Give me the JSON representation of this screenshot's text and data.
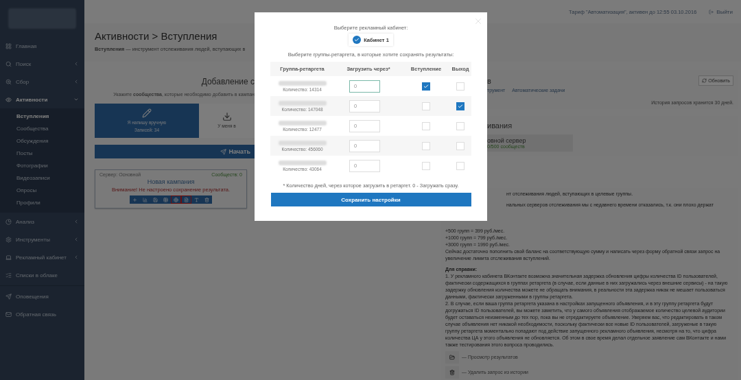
{
  "sidebar": {
    "items": [
      {
        "label": "Главная",
        "selected": false
      },
      {
        "label": "Поиск",
        "selected": false,
        "expanded": false
      },
      {
        "label": "Сбор",
        "selected": false,
        "expanded": false
      },
      {
        "label": "Активности",
        "selected": true,
        "expanded": true,
        "children": [
          {
            "label": "Вступления",
            "selected": true
          },
          {
            "label": "Сообщества",
            "selected": false
          },
          {
            "label": "Обсуждения",
            "selected": false
          },
          {
            "label": "Посты",
            "selected": false
          },
          {
            "label": "Фотографии",
            "selected": false
          },
          {
            "label": "Видеозаписи",
            "selected": false
          },
          {
            "label": "Опросы",
            "selected": false
          },
          {
            "label": "Профили",
            "selected": false
          }
        ]
      },
      {
        "label": "Анализ",
        "selected": false,
        "expanded": false
      },
      {
        "label": "Инструменты",
        "selected": false,
        "expanded": false
      },
      {
        "label": "Рекламный кабинет",
        "selected": false,
        "expanded": false
      },
      {
        "label": "Списки в облаке",
        "selected": false
      },
      {
        "label": "Оповещения",
        "selected": false
      },
      {
        "label": "Обратная связь",
        "selected": false
      }
    ]
  },
  "header": {
    "tariff": "Тариф \"Автоматизация\", активен до 12:55 03.10.2016",
    "logout": "Выйти"
  },
  "page": {
    "title": "Активности > Вступления",
    "subtitle": "**Вступления** — инструмент отслеживания людей, вступающих в"
  },
  "add_panel": {
    "heading": "Добавление с",
    "hint": "Укажите **сообщества**, которые необходимо добавить в кампан",
    "sources": [
      {
        "line1": "Я напишу вручную",
        "line2": "Записей: 34",
        "selected": true
      },
      {
        "line1": "У меня в",
        "selected": false
      }
    ],
    "start_button": "Начать"
  },
  "campaign": {
    "server": "Сервер: Основной",
    "count": "Сообществ: 0",
    "name": "Новая кампания",
    "warning": "Внимание! Не настроено сохранение результата.",
    "tools": [
      {
        "highlighted": false
      },
      {
        "highlighted": false
      },
      {
        "highlighted": false
      },
      {
        "highlighted": false
      },
      {
        "highlighted": true
      },
      {
        "highlighted": true
      },
      {
        "highlighted": false
      },
      {
        "highlighted": false
      }
    ]
  },
  "history_panel": {
    "heading": "в",
    "links": [
      "трумент",
      "Автоматические задачи"
    ],
    "refresh": "Обновить",
    "note": "История запросов хранится 30 дней."
  },
  "server_panel": {
    "heading": "ивания",
    "server": "овной сервер",
    "usage": "0/500 сообществ"
  },
  "info": {
    "cut_lines": [
      "нт отслеживания людей, вступающих в целевые группы.",
      "нальных серверов отслеживания мы с недавнего времени отказались, т.к. они плохо держат"
    ],
    "prices": [
      "+500 групп = 399 руб./мес.",
      "+1000 групп = 799 руб./мес.",
      "+3000 групп = 1990 руб./мес.",
      "Сейчас достаточно пополнить свой баланс на соответствующую сумму и написать через форму обратной связи запрос на увеличение лимита отслеживания вступлений."
    ],
    "ref_title": "Для справки:",
    "ref_text": [
      "1. У рекламного кабинета ВКонтакте возможна значительная задержка обновления цифры количества ID пользователей, фактически содержащихся в группах ретаргета (в случае, если данные в них загружались через внешние сервисы) - на такую задержку обновления количества можете не обращать внимания, в реальности эта задержка никак не мешает пользоваться данными, фактически загруженными в группы ретаргета.",
      "2. В случае, если ваша группа ретаргета указана в настройках запущенного объявления, и в эту группу ретаргета будут догружаться ID пользователей, вы можете заметить, что у самого объявления отображаемое количество целевой аудитории будет оставаться неизменным до тех пор, пока вы не отредактируете объявление. Уверяем вас, что редактировать в таком случае объявления нет никакой необходимости, поскольку фактически все новые ID пользователей, загруженые в такую группу ретаргета моментально попадают под действие запущенного рекламного объявления, несмотря на то, что цифра количества ЦА у этого объявления не обновляется. Об этом в свое время делал отдельное заявление сам ВКонтакте и нами также тестирования этого вопроса проводились."
    ],
    "actions": [
      "— Просмотр результатов",
      "— Удалить запрос из истории"
    ]
  },
  "modal": {
    "cabinet_prompt": "Выберите рекламный кабинет:",
    "cabinets": [
      {
        "label": "Кабинет 1",
        "selected": true
      }
    ],
    "groups_prompt": "Выберите группы-ретаргета, в которые хотите сохранять результаты:",
    "columns": [
      "Группа-ретаргета",
      "Загрузить через*",
      "Вступление",
      "Выход"
    ],
    "rows": [
      {
        "count": "Количество: 14314",
        "delay": "0",
        "join": true,
        "leave": false
      },
      {
        "count": "Количество: 147048",
        "delay": "0",
        "join": false,
        "leave": true
      },
      {
        "count": "Количество: 12477",
        "delay": "0",
        "join": false,
        "leave": false
      },
      {
        "count": "Количество: 456060",
        "delay": "0",
        "join": false,
        "leave": false
      },
      {
        "count": "Количество: 43064",
        "delay": "0",
        "join": false,
        "leave": false
      }
    ],
    "footnote": "* Количество дней, через которое загрузить в ретаргет. 0 - Загружать сразу.",
    "save_button": "Сохранить настройки"
  }
}
